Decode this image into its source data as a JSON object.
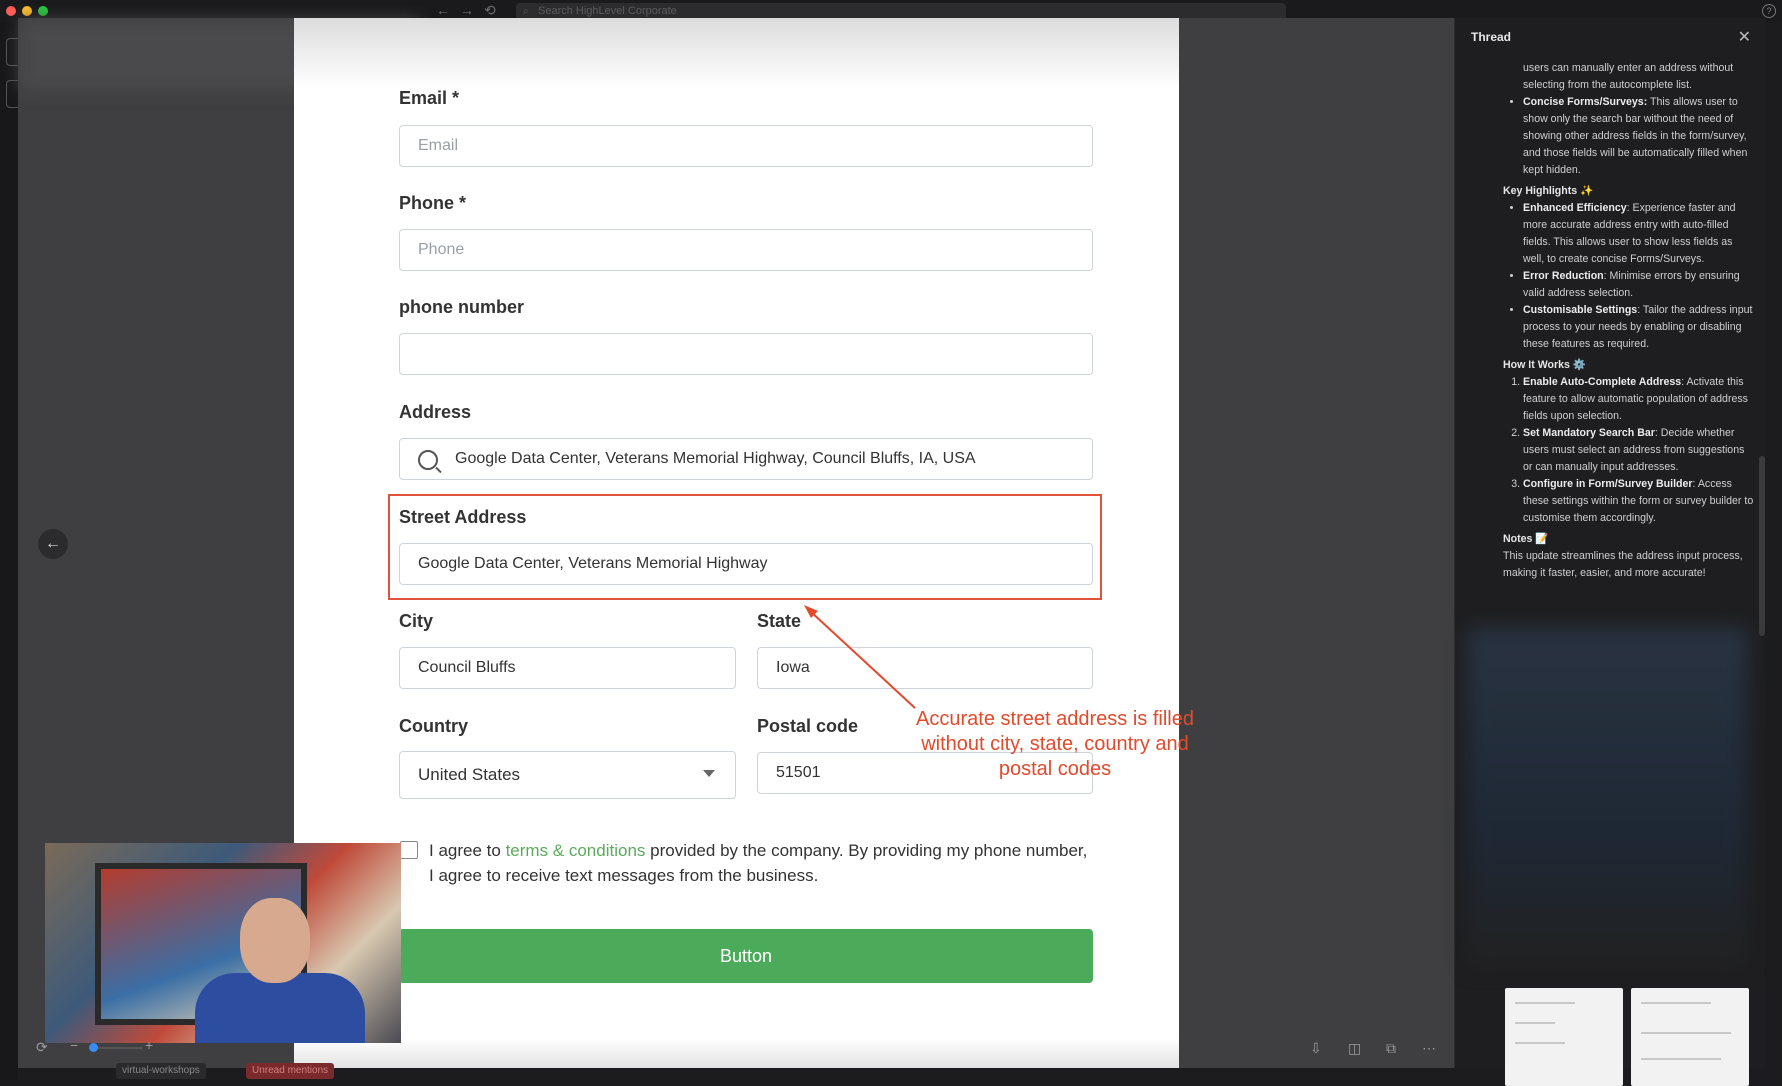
{
  "top_bar": {
    "search_placeholder": "Search HighLevel Corporate",
    "back_arrow": "←",
    "forward_arrow": "→",
    "history_icon": "⟲",
    "help": "?"
  },
  "form": {
    "email": {
      "label": "Email *",
      "placeholder": "Email"
    },
    "phone": {
      "label": "Phone *",
      "placeholder": "Phone"
    },
    "phone_number": {
      "label": "phone number",
      "value": ""
    },
    "address": {
      "label": "Address",
      "value": "Google Data Center, Veterans Memorial Highway, Council Bluffs, IA, USA"
    },
    "street_address": {
      "label": "Street Address",
      "value": "Google Data Center, Veterans Memorial Highway"
    },
    "city": {
      "label": "City",
      "value": "Council Bluffs"
    },
    "state": {
      "label": "State",
      "value": "Iowa"
    },
    "country": {
      "label": "Country",
      "value": "United States"
    },
    "postal_code": {
      "label": "Postal code",
      "value": "51501"
    },
    "agree": {
      "prefix": "I agree to ",
      "link": "terms & conditions",
      "suffix": " provided by the company. By providing my phone number, I agree to receive text messages from the business."
    },
    "submit_label": "Button"
  },
  "annotation": {
    "text": "Accurate street address is filled without city, state, country and postal codes",
    "color": "#e24a2c"
  },
  "bottom_bar": {
    "tag1": "virtual-workshops",
    "tag2": "Unread mentions"
  },
  "thread": {
    "title": "Thread",
    "intro_item": "users can manually enter an address without selecting from the autocomplete list.",
    "concise": {
      "title": "Concise Forms/Surveys:",
      "text": " This allows user to show only the search bar without the need of showing other address fields in the form/survey, and those fields will be automatically filled when kept hidden."
    },
    "key_highlights_title": "Key Highlights ✨",
    "highlights": [
      {
        "title": "Enhanced Efficiency",
        "text": ": Experience faster and more accurate address entry with auto-filled fields. This allows user to show less fields as well, to create concise Forms/Surveys."
      },
      {
        "title": "Error Reduction",
        "text": ": Minimise errors by ensuring valid address selection."
      },
      {
        "title": "Customisable Settings",
        "text": ": Tailor the address input process to your needs by enabling or disabling these features as required."
      }
    ],
    "how_title": "How It Works ⚙️",
    "steps": [
      {
        "title": "Enable Auto-Complete Address",
        "text": ": Activate this feature to allow automatic population of address fields upon selection."
      },
      {
        "title": "Set Mandatory Search Bar",
        "text": ": Decide whether users must select an address from suggestions or can manually input addresses."
      },
      {
        "title": "Configure in Form/Survey Builder",
        "text": ": Access these settings within the form or survey builder to customise them accordingly."
      }
    ],
    "notes_title": "Notes 📝",
    "notes_text": "This update streamlines the address input process, making it faster, easier, and more accurate!"
  },
  "colors": {
    "accent_green": "#4caa5b",
    "highlight_red": "#e0533a",
    "link_green": "#5caa5c"
  }
}
